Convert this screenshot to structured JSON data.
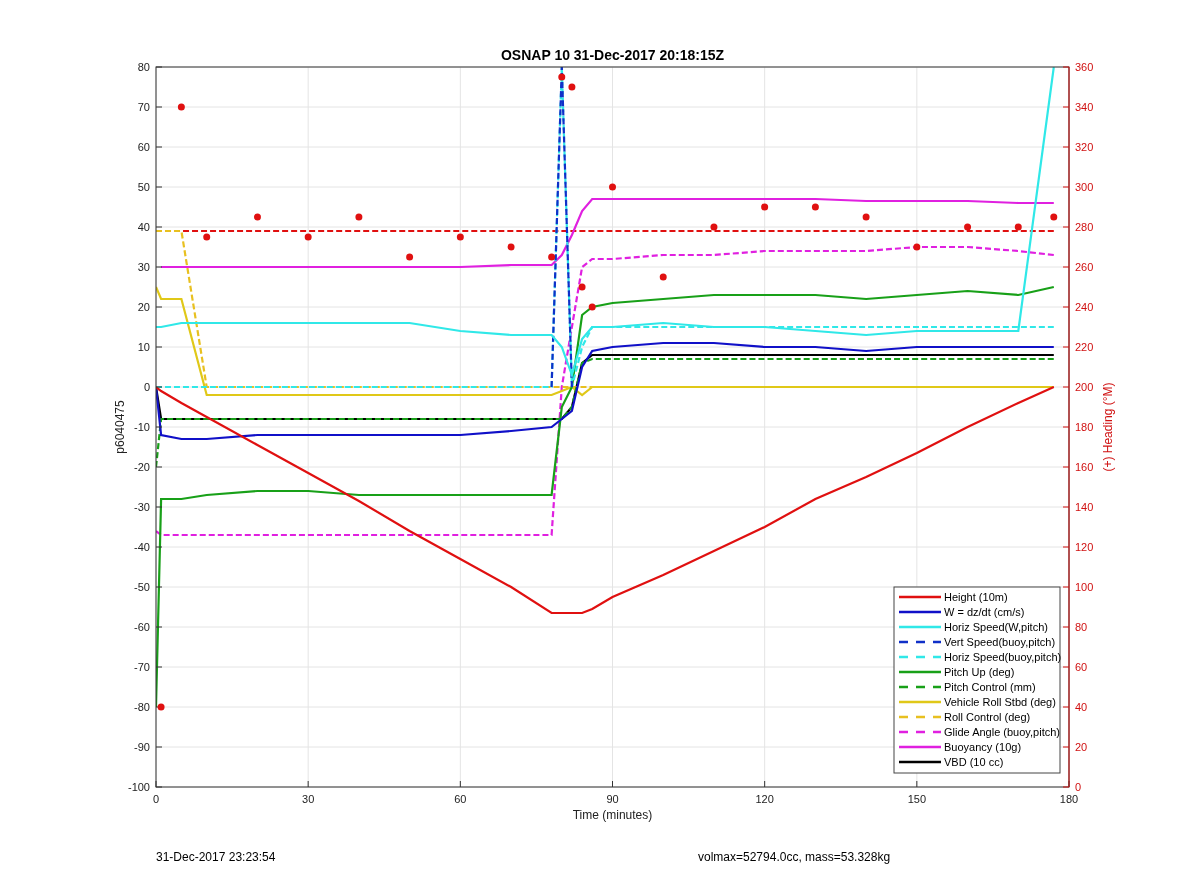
{
  "figure": {
    "chart_data": {
      "type": "line",
      "title": "OSNAP 10 31-Dec-2017 20:18:15Z",
      "xlabel": "Time (minutes)",
      "ylabel": "p6040475",
      "grid": true,
      "legend": true,
      "x": [
        0,
        1,
        5,
        10,
        20,
        30,
        40,
        50,
        60,
        70,
        78,
        80,
        82,
        84,
        86,
        90,
        100,
        110,
        120,
        130,
        140,
        150,
        160,
        170,
        177
      ],
      "xlim": [
        0,
        180
      ],
      "ylim": [
        -100,
        80
      ],
      "xticks": [
        0,
        30,
        60,
        90,
        120,
        150,
        180
      ],
      "yticks": [
        -100,
        -90,
        -80,
        -70,
        -60,
        -50,
        -40,
        -30,
        -20,
        -10,
        0,
        10,
        20,
        30,
        40,
        50,
        60,
        70,
        80
      ],
      "series": [
        {
          "name": "Height (10m)",
          "color": "#e01010",
          "line_style": "solid",
          "values": [
            0,
            -1,
            -4,
            -7.5,
            -14.5,
            -21.5,
            -28.5,
            -36,
            -43,
            -50,
            -56.5,
            -56.5,
            -56.5,
            -56.5,
            -55.5,
            -52.5,
            -47,
            -41,
            -35,
            -28,
            -22.5,
            -16.5,
            -10,
            -4,
            0
          ]
        },
        {
          "name": "W = dz/dt (cm/s)",
          "color": "#1010c8",
          "line_style": "solid",
          "values": [
            0,
            -12,
            -13,
            -13,
            -12,
            -12,
            -12,
            -12,
            -12,
            -11,
            -10,
            -8,
            -6,
            5,
            9,
            10,
            11,
            11,
            10,
            10,
            9,
            10,
            10,
            10,
            10
          ]
        },
        {
          "name": "Horiz Speed(W,pitch)",
          "color": "#30e8e8",
          "line_style": "solid",
          "values": [
            15,
            15,
            16,
            16,
            16,
            16,
            16,
            16,
            14,
            13,
            13,
            10,
            3,
            12,
            15,
            15,
            16,
            15,
            15,
            14,
            13,
            14,
            14,
            14,
            80
          ]
        },
        {
          "name": "Vert Speed(buoy,pitch)",
          "color": "#1030c8",
          "line_style": "dashed",
          "values": [
            null,
            null,
            null,
            null,
            null,
            null,
            null,
            null,
            null,
            null,
            0,
            80,
            0,
            null,
            null,
            null,
            null,
            null,
            null,
            null,
            null,
            null,
            null,
            null,
            null
          ]
        },
        {
          "name": "Horiz Speed(buoy,pitch)",
          "color": "#30e8e8",
          "line_style": "dashed",
          "values": [
            0,
            0,
            0,
            0,
            0,
            0,
            0,
            0,
            0,
            0,
            0,
            80,
            0,
            10,
            15,
            15,
            15,
            15,
            15,
            15,
            15,
            15,
            15,
            15,
            15
          ]
        },
        {
          "name": "Pitch Up (deg)",
          "color": "#18a018",
          "line_style": "solid",
          "values": [
            -80,
            -28,
            -28,
            -27,
            -26,
            -26,
            -27,
            -27,
            -27,
            -27,
            -27,
            -5,
            0,
            18,
            20,
            21,
            22,
            23,
            23,
            23,
            22,
            23,
            24,
            23,
            25
          ]
        },
        {
          "name": "Pitch Control (mm)",
          "color": "#18a018",
          "line_style": "dashed",
          "values": [
            -20,
            -8,
            -8,
            -8,
            -8,
            -8,
            -8,
            -8,
            -8,
            -8,
            -8,
            -8,
            -5,
            6,
            7,
            7,
            7,
            7,
            7,
            7,
            7,
            7,
            7,
            7,
            7
          ]
        },
        {
          "name": "Vehicle Roll Stbd (deg)",
          "color": "#e0c818",
          "line_style": "solid",
          "values": [
            25,
            22,
            22,
            -2,
            -2,
            -2,
            -2,
            -2,
            -2,
            -2,
            -2,
            -1,
            0,
            -2,
            0,
            0,
            0,
            0,
            0,
            0,
            0,
            0,
            0,
            0,
            0
          ]
        },
        {
          "name": "Roll Control (deg)",
          "color": "#e8c020",
          "line_style": "dashed",
          "values": [
            39,
            39,
            39,
            0,
            0,
            0,
            0,
            0,
            0,
            0,
            0,
            0,
            0,
            0,
            0,
            0,
            0,
            0,
            0,
            0,
            0,
            0,
            0,
            0,
            0
          ]
        },
        {
          "name": "Glide Angle (buoy,pitch)",
          "color": "#e020e0",
          "line_style": "dashed",
          "values": [
            -36,
            -37,
            -37,
            -37,
            -37,
            -37,
            -37,
            -37,
            -37,
            -37,
            -37,
            0,
            15,
            30,
            32,
            32,
            33,
            33,
            34,
            34,
            34,
            35,
            35,
            34,
            33
          ]
        },
        {
          "name": "Buoyancy (10g)",
          "color": "#e020e0",
          "line_style": "solid",
          "values": [
            null,
            30,
            30,
            30,
            30,
            30,
            30,
            30,
            30,
            30.5,
            30.5,
            33,
            38,
            44,
            47,
            47,
            47,
            47,
            47,
            47,
            46.5,
            46.5,
            46.5,
            46,
            46
          ]
        },
        {
          "name": "VBD (10 cc)",
          "color": "#000000",
          "line_style": "solid",
          "values": [
            0,
            -8,
            -8,
            -8,
            -8,
            -8,
            -8,
            -8,
            -8,
            -8,
            -8,
            -8,
            -5,
            6,
            8,
            8,
            8,
            8,
            8,
            8,
            8,
            8,
            8,
            8,
            8
          ]
        },
        {
          "color": "#e01010",
          "line_style": "dashed",
          "values": [
            39,
            39,
            39,
            39,
            39,
            39,
            39,
            39,
            39,
            39,
            39,
            39,
            39,
            39,
            39,
            39,
            39,
            39,
            39,
            39,
            39,
            39,
            39,
            39,
            39
          ]
        }
      ]
    },
    "heading_overlay": {
      "chart_data": {
        "type": "scatter",
        "ylabel": "(+) Heading (°M)",
        "x": [
          1,
          5,
          10,
          20,
          30,
          40,
          50,
          60,
          70,
          78,
          80,
          82,
          84,
          86,
          90,
          100,
          110,
          120,
          130,
          140,
          150,
          160,
          170,
          177
        ],
        "xlim": [
          0,
          180
        ],
        "ylim": [
          0,
          360
        ],
        "yticks": [
          0,
          20,
          40,
          60,
          80,
          100,
          120,
          140,
          160,
          180,
          200,
          220,
          240,
          260,
          280,
          300,
          320,
          340,
          360
        ],
        "series": [
          {
            "color": "#e01010",
            "marker": "circle",
            "values": [
              40,
              340,
              275,
              285,
              275,
              285,
              265,
              275,
              270,
              265,
              355,
              350,
              250,
              240,
              300,
              255,
              280,
              290,
              290,
              285,
              270,
              280,
              280,
              285
            ]
          }
        ]
      }
    },
    "footer_left": "31-Dec-2017 23:23:54",
    "footer_right": "volmax=52794.0cc, mass=53.328kg"
  }
}
